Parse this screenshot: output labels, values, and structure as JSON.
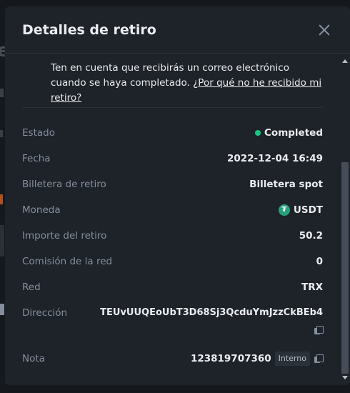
{
  "modal": {
    "title": "Detalles de retiro",
    "notice_text": "Ten en cuenta que recibirás un correo electrónico cuando se haya completado. ",
    "notice_link": "¿Por qué no he recibido mi retiro?"
  },
  "details": {
    "status_label": "Estado",
    "status_value": "Completed",
    "status_color": "#0ecb81",
    "date_label": "Fecha",
    "date_value": "2022-12-04 16:49",
    "wallet_label": "Billetera de retiro",
    "wallet_value": "Billetera spot",
    "coin_label": "Moneda",
    "coin_value": "USDT",
    "coin_icon": "tether-icon",
    "amount_label": "Importe del retiro",
    "amount_value": "50.2",
    "fee_label": "Comisión de la red",
    "fee_value": "0",
    "network_label": "Red",
    "network_value": "TRX",
    "address_label": "Dirección",
    "address_value": "TEUvUUQEoUbT3D68Sj3QcduYmJzzCkBEb4",
    "note_label": "Nota",
    "note_value": "123819707360",
    "note_badge": "Interno"
  },
  "background": {
    "partial_letter": "e"
  }
}
